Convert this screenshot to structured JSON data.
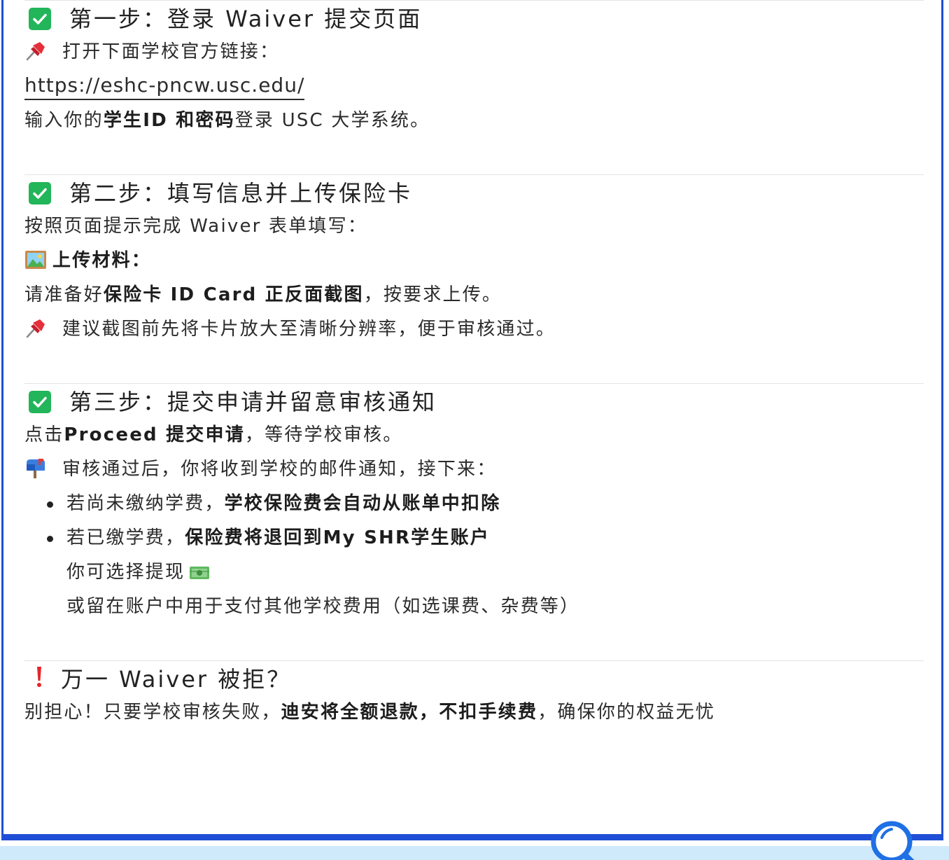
{
  "step1": {
    "heading": "第一步：登录 Waiver 提交页面",
    "open_text": "打开下面学校官方链接：",
    "url": "https://eshc-pncw.usc.edu/",
    "login_pre": "输入你的",
    "login_bold": "学生ID 和密码",
    "login_post": "登录 USC 大学系统。"
  },
  "step2": {
    "heading": "第二步：填写信息并上传保险卡",
    "instruction": "按照页面提示完成 Waiver 表单填写：",
    "upload_label": "上传材料：",
    "prepare_pre": "请准备好",
    "prepare_bold": "保险卡 ID Card 正反面截图",
    "prepare_post": "，按要求上传。",
    "tip": "建议截图前先将卡片放大至清晰分辨率，便于审核通过。"
  },
  "step3": {
    "heading": "第三步：提交申请并留意审核通知",
    "click_pre": "点击",
    "click_bold": "Proceed 提交申请",
    "click_post": "，等待学校审核。",
    "notice": "审核通过后，你将收到学校的邮件通知，接下来：",
    "bullet1_pre": "若尚未缴纳学费，",
    "bullet1_bold": "学校保险费会自动从账单中扣除",
    "bullet2_pre": "若已缴学费，",
    "bullet2_bold": "保险费将退回到My SHR学生账户",
    "withdraw": "你可选择提现",
    "keep": "或留在账户中用于支付其他学校费用（如选课费、杂费等）"
  },
  "rejected": {
    "heading": "万一 Waiver 被拒？",
    "text_pre": "别担心！只要学校审核失败，",
    "text_bold": "迪安将全额退款，不扣手续费",
    "text_post": "，确保你的权益无忧"
  },
  "icons": [
    "check-icon",
    "pin-icon",
    "picture-icon",
    "mailbox-icon",
    "money-icon",
    "exclamation-icon",
    "magnifier-icon"
  ],
  "colors": {
    "accent": "#1f4fd6",
    "check": "#22b55a",
    "band": "#cfeafb"
  }
}
